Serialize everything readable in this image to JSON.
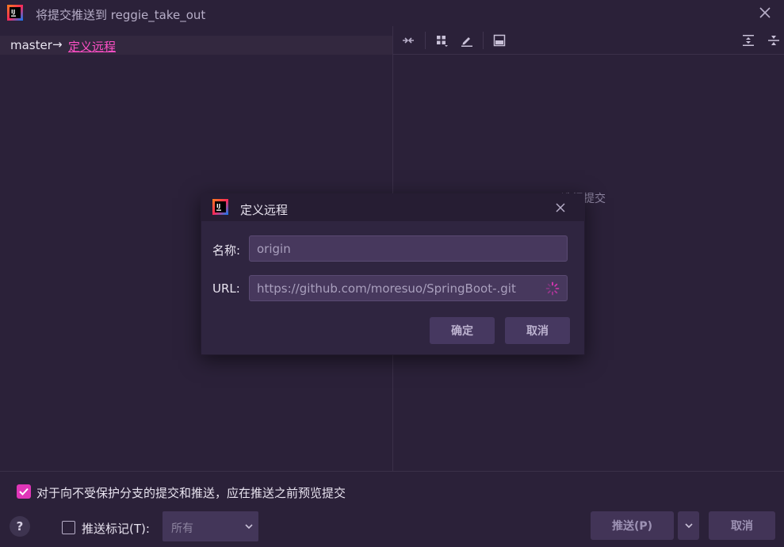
{
  "window": {
    "title": "将提交推送到 reggie_take_out"
  },
  "left_pane": {
    "branch_local": "master",
    "arrow": "→",
    "define_remote_link": "定义远程"
  },
  "right_pane": {
    "toolbar_icons": [
      "collapse-arrows-icon",
      "group-by-icon",
      "edit-icon",
      "preview-panel-icon",
      "expand-all-icon",
      "collapse-all-icon"
    ],
    "empty_hint": "选择提交"
  },
  "bottom": {
    "preview_checkbox_checked": true,
    "preview_checkbox_label": "对于向不受保护分支的提交和推送，应在推送之前预览提交",
    "help_label": "?",
    "push_tags_checked": false,
    "push_tags_label": "推送标记(T):",
    "tags_select_value": "所有",
    "push_button": "推送(P)",
    "cancel_button": "取消"
  },
  "modal": {
    "title": "定义远程",
    "name_label": "名称:",
    "name_value": "origin",
    "url_label": "URL:",
    "url_value": "https://github.com/moresuo/SpringBoot-.git",
    "ok_button": "确定",
    "cancel_button": "取消"
  },
  "colors": {
    "background": "#2b2139",
    "accent": "#e036b8",
    "link": "#ff4fc6",
    "button": "#423457"
  }
}
